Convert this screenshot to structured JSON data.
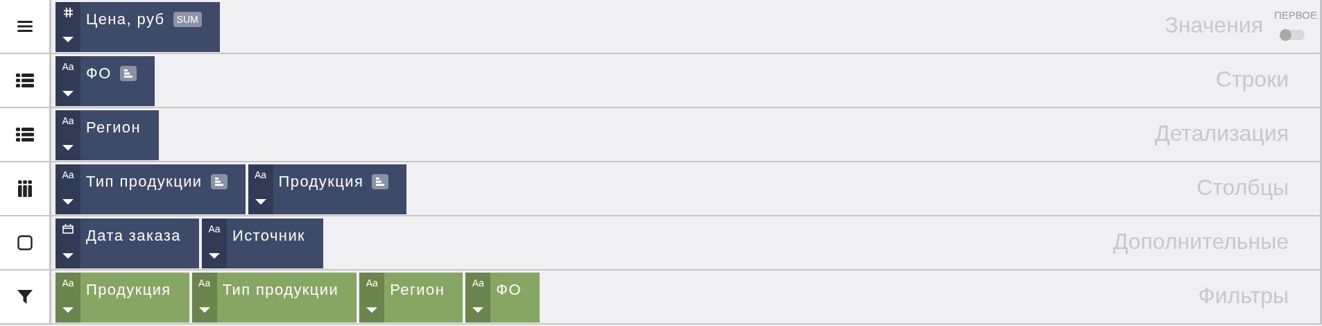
{
  "sections": [
    {
      "kind": "values",
      "title": "Значения",
      "toggle": {
        "label": "ПЕРВОЕ",
        "on": false
      },
      "fields": [
        {
          "kind": "number",
          "name": "Цена, руб",
          "badge": "SUM"
        }
      ]
    },
    {
      "kind": "rows",
      "title": "Строки",
      "fields": [
        {
          "kind": "text",
          "glyph": "Aa",
          "name": "ФО",
          "sorted": true
        }
      ]
    },
    {
      "kind": "details",
      "title": "Детализация",
      "fields": [
        {
          "kind": "text",
          "glyph": "Aa",
          "name": "Регион"
        }
      ]
    },
    {
      "kind": "columns",
      "title": "Столбцы",
      "fields": [
        {
          "kind": "text",
          "glyph": "Aa",
          "name": "Тип продукции",
          "sorted": true
        },
        {
          "kind": "text",
          "glyph": "Aa",
          "name": "Продукция",
          "sorted": true
        }
      ]
    },
    {
      "kind": "extra",
      "title": "Дополнительные",
      "fields": [
        {
          "kind": "date",
          "name": "Дата заказа"
        },
        {
          "kind": "text",
          "glyph": "Aa",
          "name": "Источник"
        }
      ]
    },
    {
      "kind": "filters",
      "title": "Фильтры",
      "fields": [
        {
          "kind": "text",
          "glyph": "Aa",
          "name": "Продукция"
        },
        {
          "kind": "text",
          "glyph": "Aa",
          "name": "Тип продукции"
        },
        {
          "kind": "text",
          "glyph": "Aa",
          "name": "Регион"
        },
        {
          "kind": "text",
          "glyph": "Aa",
          "name": "ФО"
        }
      ]
    }
  ]
}
